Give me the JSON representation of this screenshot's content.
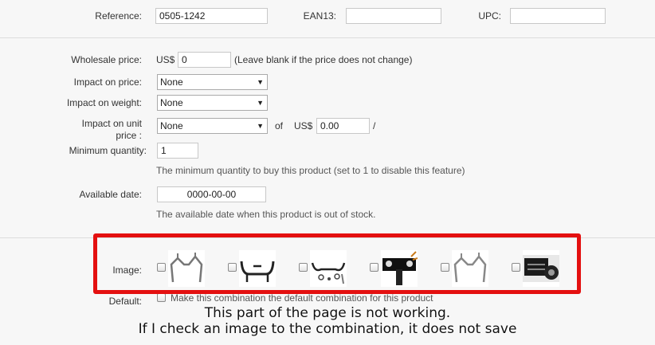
{
  "reference": {
    "label": "Reference:",
    "value": "0505-1242"
  },
  "ean13": {
    "label": "EAN13:",
    "value": ""
  },
  "upc": {
    "label": "UPC:",
    "value": ""
  },
  "wholesale": {
    "label": "Wholesale price:",
    "currency": "US$",
    "value": "0",
    "note": "(Leave blank if the price does not change)"
  },
  "impact_price": {
    "label": "Impact on price:",
    "value": "None"
  },
  "impact_weight": {
    "label": "Impact on weight:",
    "value": "None"
  },
  "impact_unit": {
    "label_line1": "Impact on unit",
    "label_line2": "price :",
    "value": "None",
    "of": "of",
    "currency": "US$",
    "amount": "0.00",
    "slash": "/"
  },
  "min_qty": {
    "label": "Minimum quantity:",
    "value": "1",
    "hint": "The minimum quantity to buy this product (set to 1 to disable this feature)"
  },
  "avail_date": {
    "label": "Available date:",
    "value": "0000-00-00",
    "hint": "The available date when this product is out of stock."
  },
  "image": {
    "label": "Image:",
    "count": 6
  },
  "default": {
    "label": "Default:",
    "text": "Make this combination the default combination for this product"
  },
  "annotation": {
    "line1": "This part of the page is not working.",
    "line2": "If I check an image to the combination, it does not save",
    "color": "#e41010"
  },
  "icons": [
    "chevron-down-icon",
    "checkbox-icon",
    "product-thumbnail-icon"
  ]
}
